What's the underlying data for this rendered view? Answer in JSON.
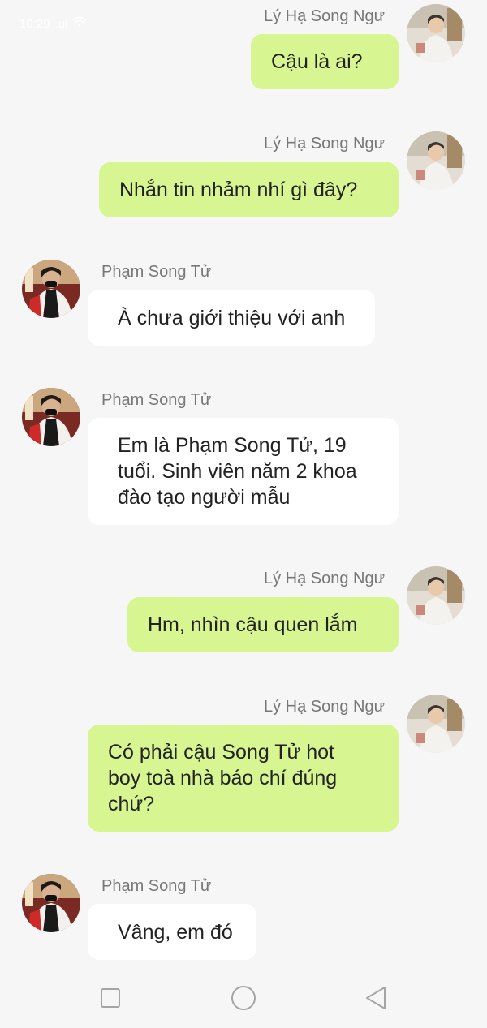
{
  "status_bar": {
    "time": "10:29",
    "network": ".ul",
    "battery": "68"
  },
  "contacts": {
    "right_name": "Lý Hạ Song Ngư",
    "left_name": "Phạm Song Tử"
  },
  "messages": [
    {
      "side": "right",
      "sender": "Lý Hạ Song Ngư",
      "text": "Cậu là ai?"
    },
    {
      "side": "right",
      "sender": "Lý Hạ Song Ngư",
      "text": "Nhắn tin nhảm nhí gì đây?"
    },
    {
      "side": "left",
      "sender": "Phạm Song Tử",
      "text": "À chưa giới thiệu với anh"
    },
    {
      "side": "left",
      "sender": "Phạm Song Tử",
      "lines": [
        "Em là Phạm Song Tử, 19",
        "tuổi. Sinh viên năm 2 khoa",
        "đào tạo người mẫu"
      ]
    },
    {
      "side": "right",
      "sender": "Lý Hạ Song Ngư",
      "text": "Hm, nhìn cậu quen lắm"
    },
    {
      "side": "right",
      "sender": "Lý Hạ Song Ngư",
      "lines": [
        "Có phải cậu Song Tử hot",
        "boy toà nhà báo chí đúng",
        "chứ?"
      ]
    },
    {
      "side": "left",
      "sender": "Phạm Song Tử",
      "text": "Vâng, em đó"
    }
  ],
  "colors": {
    "right_bubble": "#d7f590",
    "left_bubble": "#ffffff",
    "background": "#f6f6f6"
  },
  "navigation": {
    "icons": [
      "square-icon",
      "circle-icon",
      "triangle-back-icon"
    ]
  }
}
